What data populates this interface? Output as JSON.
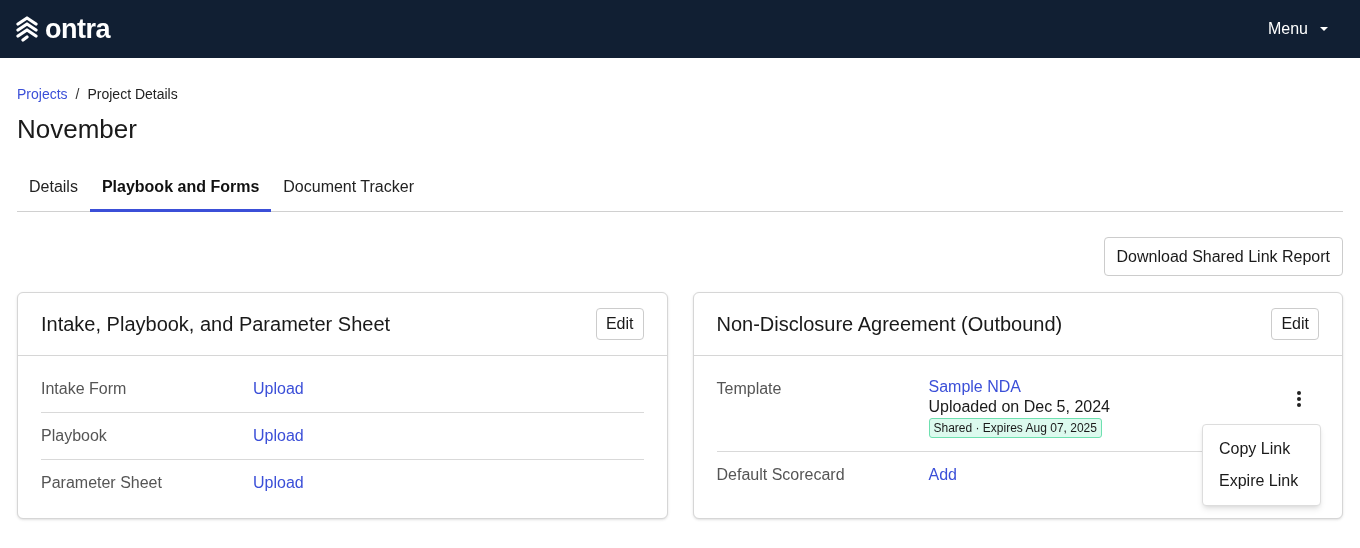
{
  "header": {
    "logo": "ontra",
    "menu": "Menu"
  },
  "breadcrumb_separator": "/",
  "breadcrumb": [
    {
      "label": "Projects",
      "kind": "link"
    },
    {
      "label": "Project Details",
      "kind": "current"
    }
  ],
  "title": "November",
  "tabs": [
    {
      "label": "Details",
      "selected": false
    },
    {
      "label": "Playbook and Forms",
      "selected": true
    },
    {
      "label": "Document Tracker",
      "selected": false
    }
  ],
  "action_button": "Download Shared Link Report",
  "cards": [
    {
      "title": "Intake, Playbook, and Parameter Sheet",
      "edit": "Edit",
      "rows": [
        {
          "kind": "action",
          "label": "Intake Form",
          "action": "Upload"
        },
        {
          "kind": "action",
          "label": "Playbook",
          "action": "Upload"
        },
        {
          "kind": "action",
          "label": "Parameter Sheet",
          "action": "Upload"
        }
      ]
    },
    {
      "title": "Non-Disclosure Agreement (Outbound)",
      "edit": "Edit",
      "rows": [
        {
          "kind": "file",
          "label": "Template",
          "file": "Sample NDA",
          "uploaded": "Uploaded on Dec 5, 2024",
          "badge": "Shared · Expires Aug 07, 2025",
          "menu_open": true,
          "menu": [
            "Copy Link",
            "Expire Link"
          ]
        },
        {
          "kind": "action",
          "label": "Default Scorecard",
          "action": "Add"
        }
      ]
    }
  ]
}
